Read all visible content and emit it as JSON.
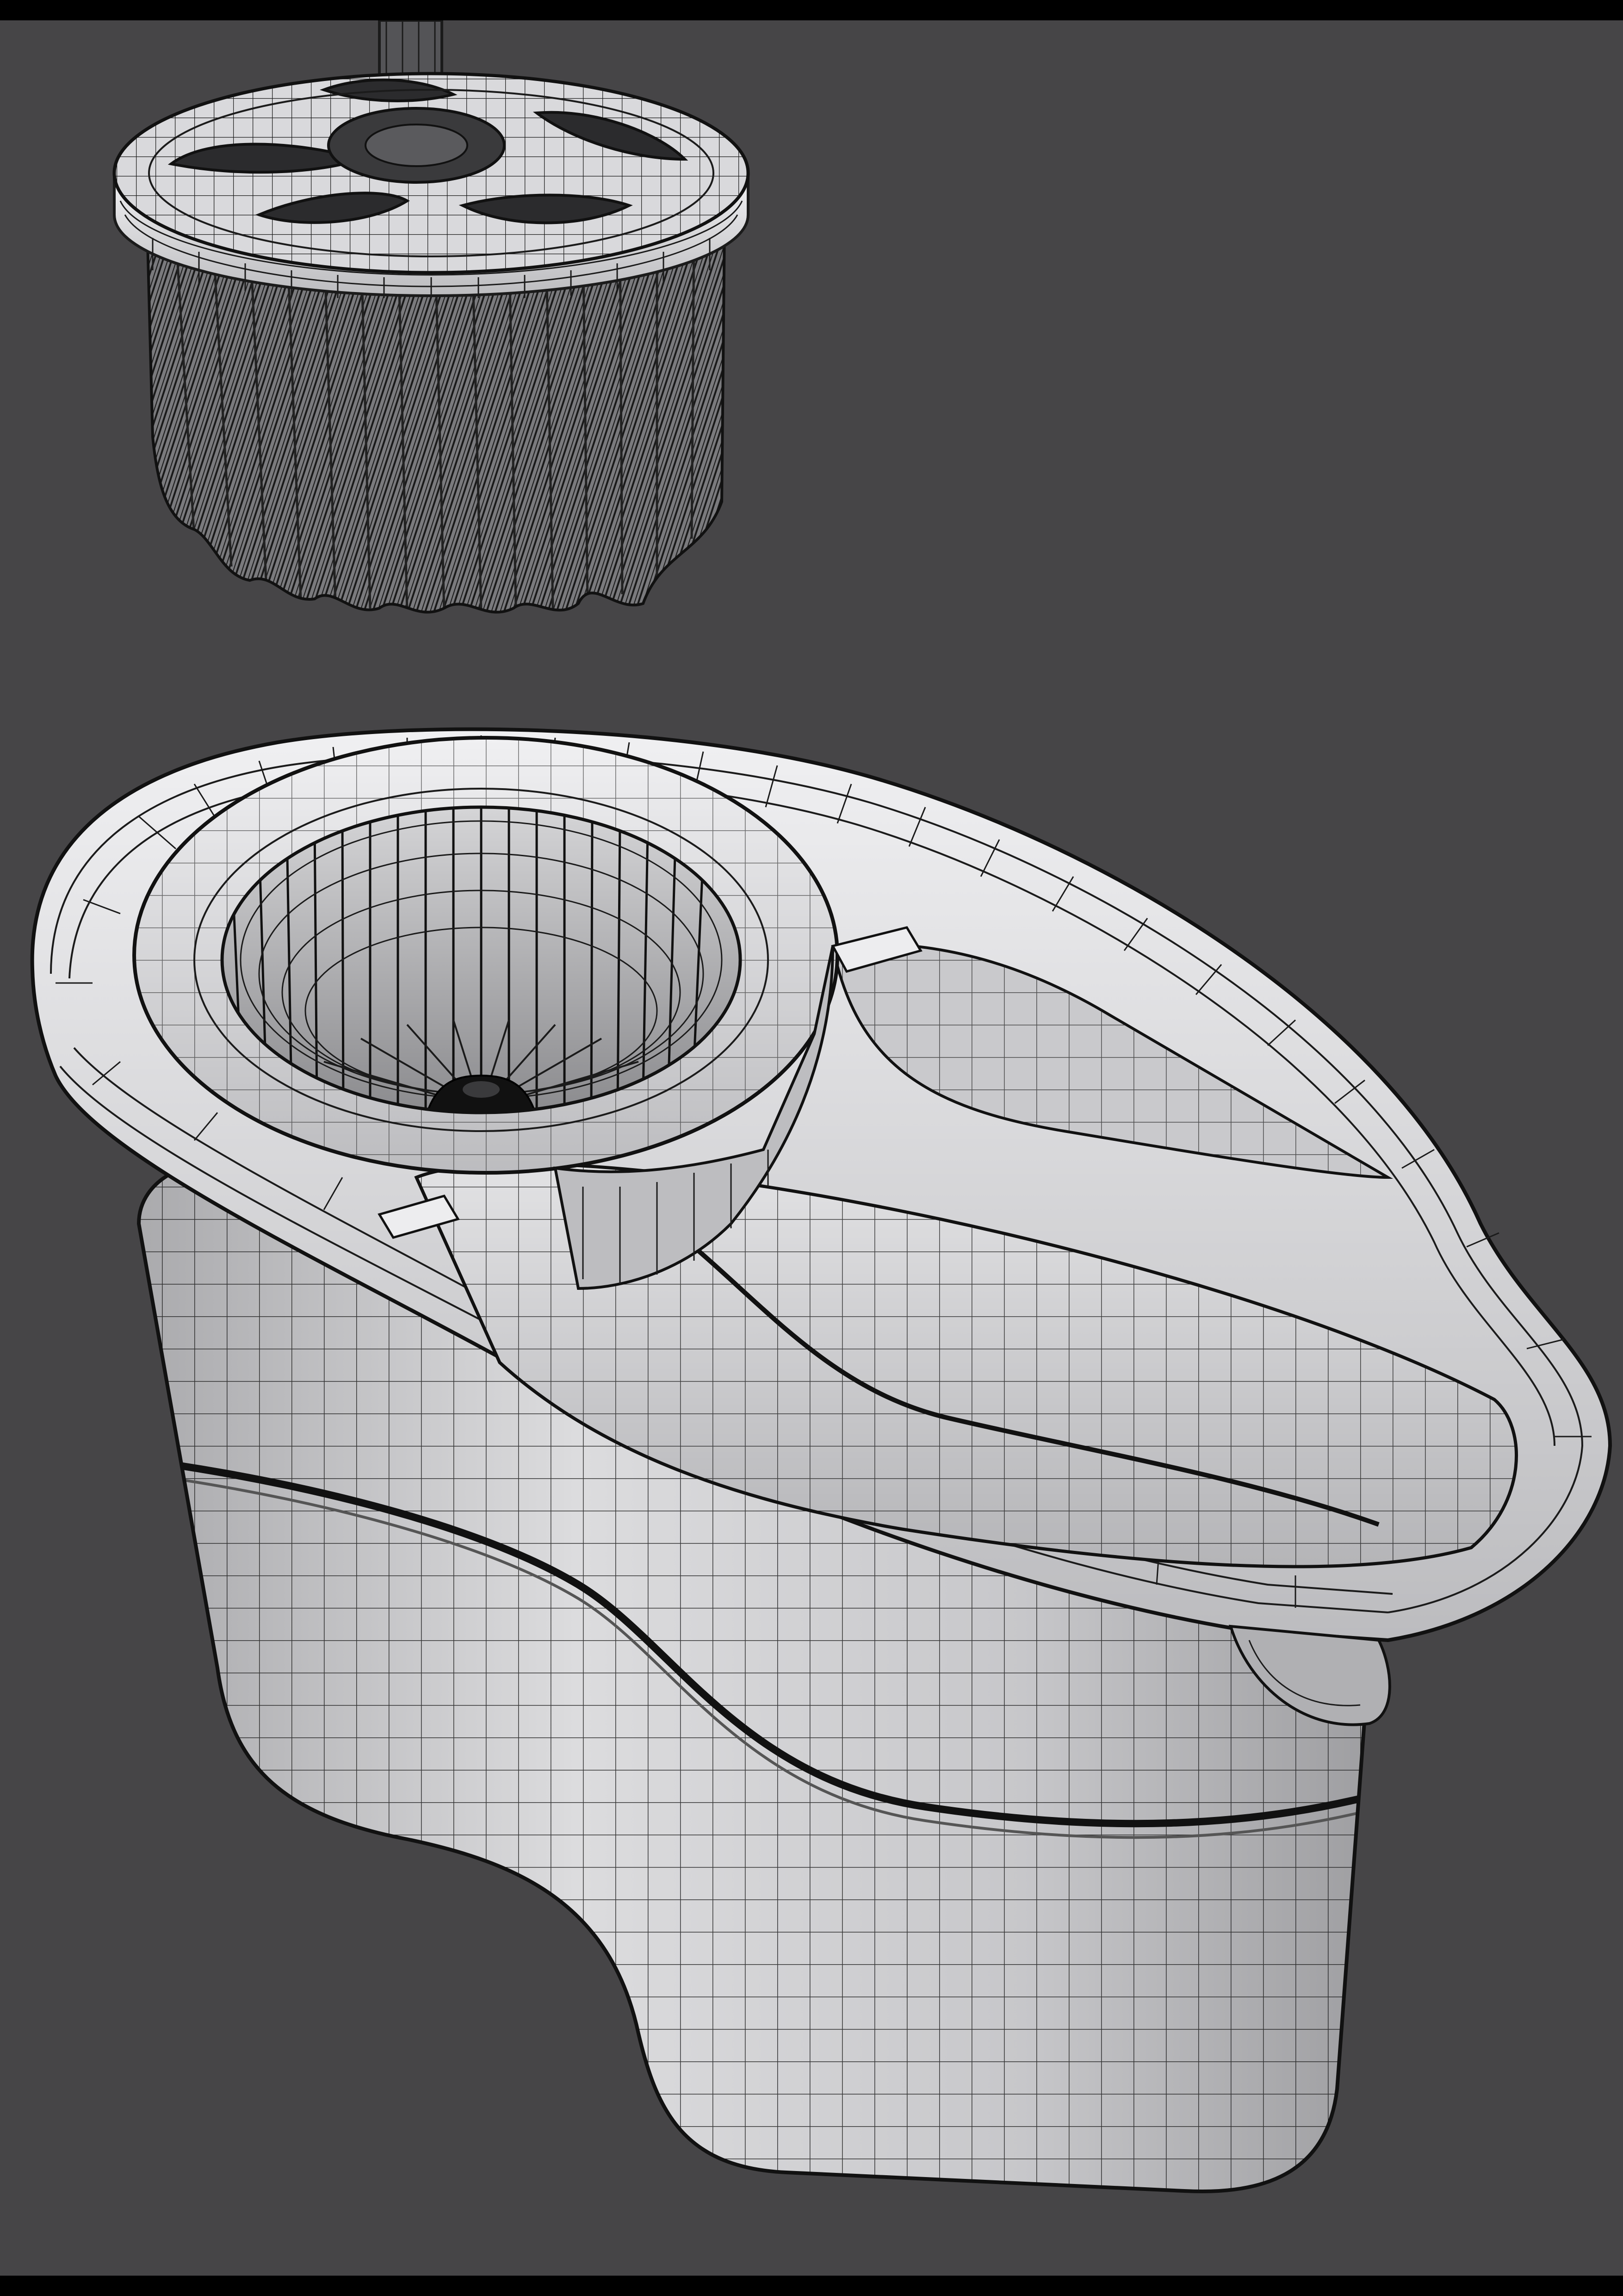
{
  "scene": {
    "description_free": true,
    "colors": {
      "background": "#464547",
      "frame": "#000000",
      "surface_light": "#e4e4e6",
      "surface_mid": "#b9b9bc",
      "surface_dark": "#7d7d80",
      "wire": "#1b1b1b",
      "fiber_dark": "#2a2a2a"
    },
    "objects": [
      {
        "name": "mop-head",
        "icon": "wireframe-mop-head"
      },
      {
        "name": "spin-bucket",
        "icon": "wireframe-spin-bucket"
      }
    ]
  }
}
